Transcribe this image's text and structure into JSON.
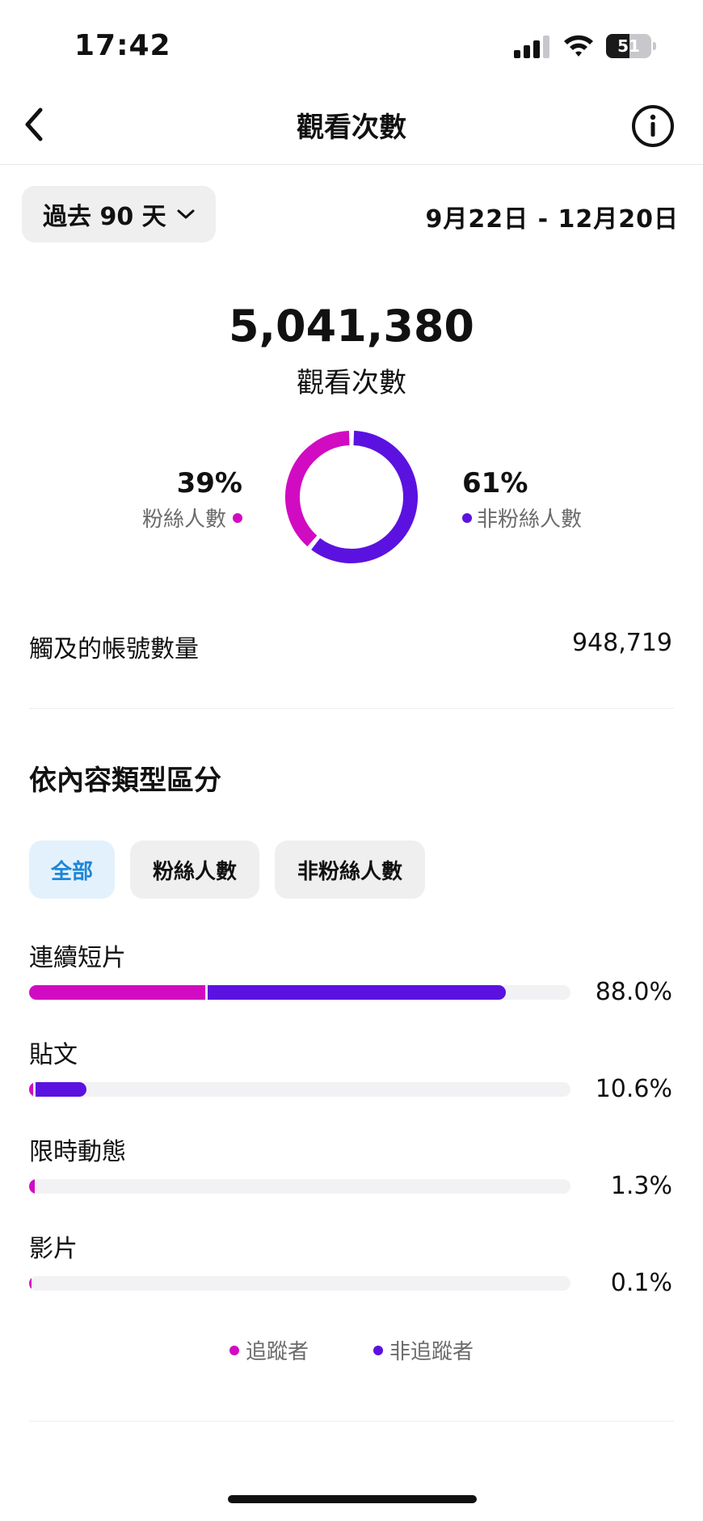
{
  "status_bar": {
    "time": "17:42",
    "battery": "51",
    "battery_level": 0.51
  },
  "header": {
    "title": "觀看次數",
    "back_icon": "chevron-left-icon",
    "info_icon": "info-icon"
  },
  "filter": {
    "period_label": "過去 90 天",
    "date_range": "9月22日 - 12月20日"
  },
  "summary": {
    "total_value": "5,041,380",
    "total_label": "觀看次數",
    "followers": {
      "percent_text": "39%",
      "label": "粉絲人數",
      "value": 39
    },
    "non_followers": {
      "percent_text": "61%",
      "label": "非粉絲人數",
      "value": 61
    }
  },
  "reach": {
    "label": "觸及的帳號數量",
    "value": "948,719"
  },
  "content_types": {
    "title": "依內容類型區分",
    "tabs": [
      {
        "label": "全部",
        "active": true
      },
      {
        "label": "粉絲人數",
        "active": false
      },
      {
        "label": "非粉絲人數",
        "active": false
      }
    ],
    "rows": [
      {
        "label": "連續短片",
        "percent_text": "88.0%",
        "followers": 32.5,
        "non_followers": 55.5
      },
      {
        "label": "貼文",
        "percent_text": "10.6%",
        "followers": 0.8,
        "non_followers": 9.8
      },
      {
        "label": "限時動態",
        "percent_text": "1.3%",
        "followers": 1.0,
        "non_followers": 0.3
      },
      {
        "label": "影片",
        "percent_text": "0.1%",
        "followers": 0.05,
        "non_followers": 0.05
      }
    ],
    "legend": {
      "followers": "追蹤者",
      "non_followers": "非追蹤者"
    }
  },
  "colors": {
    "followers": "#d10bc2",
    "non_followers": "#5b12e0",
    "track": "#f2f2f4",
    "active_tab_text": "#1d86d8",
    "active_tab_bg": "#e3f1fd"
  }
}
